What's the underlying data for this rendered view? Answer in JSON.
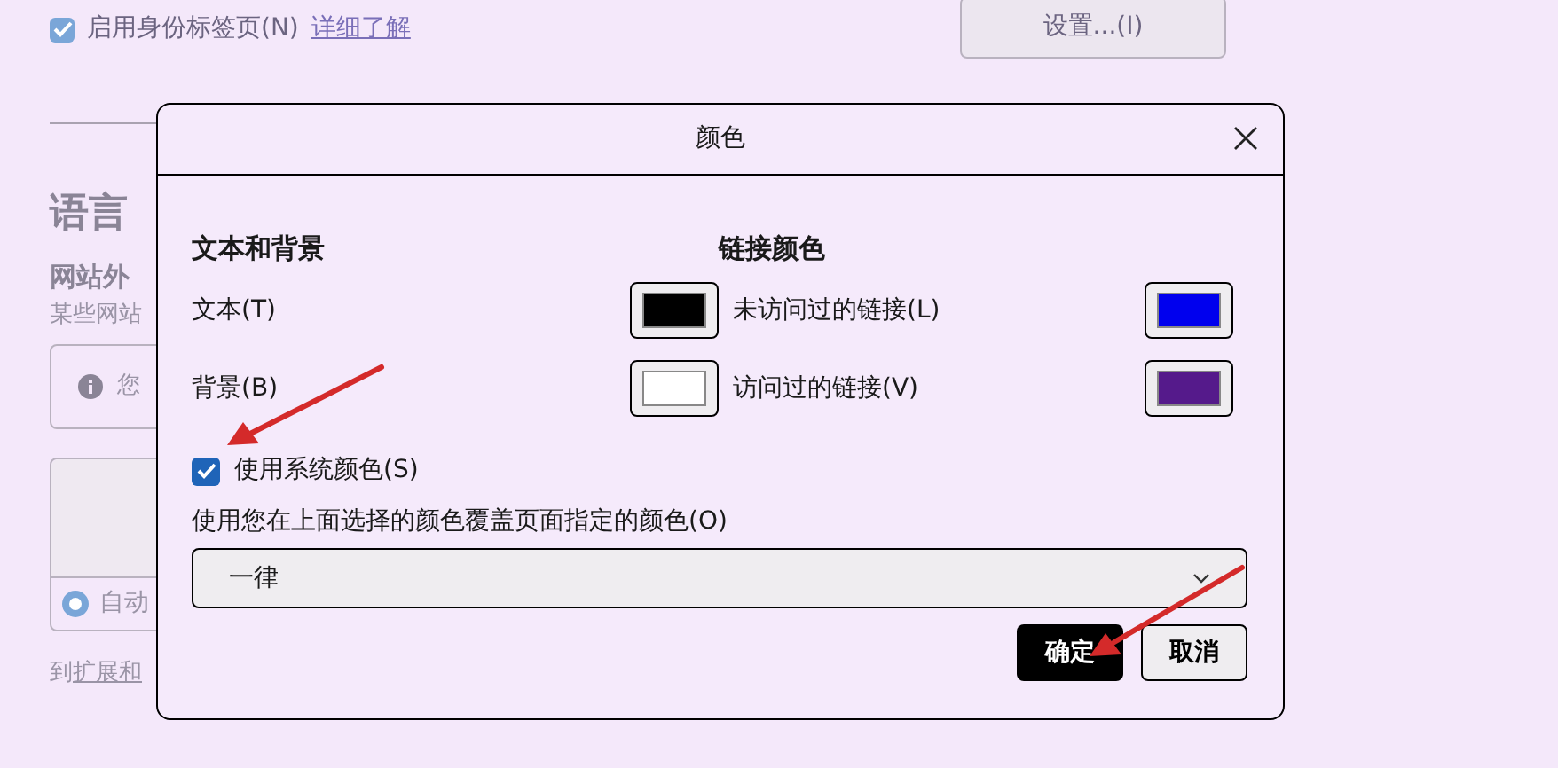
{
  "page": {
    "identity_tabs": {
      "label": "启用身份标签页(N)",
      "checked": true,
      "link": "详细了解"
    },
    "settings_button": "设置...(I)",
    "section_heading": "语言",
    "subheading": "网站外",
    "description": "某些网站",
    "info_text": "您",
    "radio": {
      "label": "自动",
      "selected": true
    },
    "bottom_text": "到",
    "bottom_link": "扩展和"
  },
  "dialog": {
    "title": "颜色",
    "text_and_background": {
      "heading": "文本和背景",
      "rows": [
        {
          "label": "文本(T)",
          "color": "#000000"
        },
        {
          "label": "背景(B)",
          "color": "#ffffff"
        }
      ]
    },
    "link_colors": {
      "heading": "链接颜色",
      "rows": [
        {
          "label": "未访问过的链接(L)",
          "color": "#0000ee"
        },
        {
          "label": "访问过的链接(V)",
          "color": "#551a8b"
        }
      ]
    },
    "system_colors": {
      "label": "使用系统颜色(S)",
      "checked": true
    },
    "override": {
      "label": "使用您在上面选择的颜色覆盖页面指定的颜色(O)",
      "value": "一律"
    },
    "buttons": [
      {
        "label": "确定",
        "primary": true
      },
      {
        "label": "取消",
        "primary": false
      }
    ]
  }
}
